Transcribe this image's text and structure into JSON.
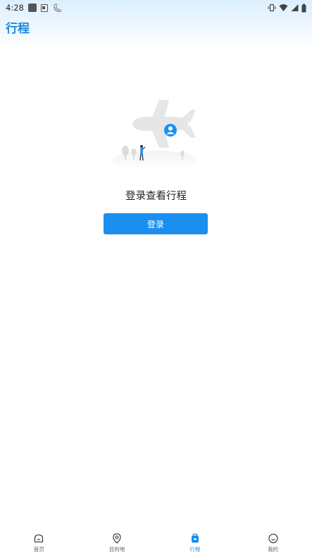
{
  "status_bar": {
    "time": "4:28",
    "icons": [
      "app-square-icon",
      "image-icon",
      "bug-icon",
      "vibrate-icon",
      "wifi-icon",
      "signal-icon",
      "battery-icon"
    ]
  },
  "header": {
    "title": "行程"
  },
  "main": {
    "illustration": "plane-user-illustration",
    "prompt": "登录查看行程",
    "login_button": "登录"
  },
  "bottom_nav": {
    "items": [
      {
        "label": "首页",
        "icon": "home-icon",
        "active": false
      },
      {
        "label": "目的地",
        "icon": "location-pin-icon",
        "active": false
      },
      {
        "label": "行程",
        "icon": "luggage-icon",
        "active": true
      },
      {
        "label": "我的",
        "icon": "smile-face-icon",
        "active": false
      }
    ]
  },
  "colors": {
    "accent": "#1b8ff0",
    "title": "#1f86e0"
  }
}
